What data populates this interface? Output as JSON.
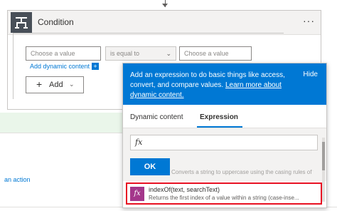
{
  "condition_card": {
    "title": "Condition",
    "more_label": "···",
    "left_value_placeholder": "Choose a value",
    "operator": "is equal to",
    "right_value_placeholder": "Choose a value",
    "add_dynamic_content": "Add dynamic content",
    "add_button_label": "Add"
  },
  "background": {
    "action_link": "an action"
  },
  "popup": {
    "description": "Add an expression to do basic things like access, convert, and compare values.",
    "learn_more": "Learn more about dynamic content.",
    "hide_label": "Hide",
    "tabs": [
      {
        "label": "Dynamic content",
        "active": false
      },
      {
        "label": "Expression",
        "active": true
      }
    ],
    "expression_input_value": "",
    "ok_label": "OK",
    "faded_row_text": "Converts a string to uppercase using the casing rules of th",
    "function_item": {
      "name": "indexOf(text, searchText)",
      "description": "Returns the first index of a value within a string (case-inse..."
    }
  },
  "colors": {
    "accent": "#0078d4",
    "highlight_border": "#e81123",
    "function_icon": "#a4378b",
    "header_icon": "#484f58"
  },
  "icons": [
    "condition-icon",
    "chevron-down-icon",
    "plus-icon",
    "fx-icon",
    "function-icon"
  ]
}
